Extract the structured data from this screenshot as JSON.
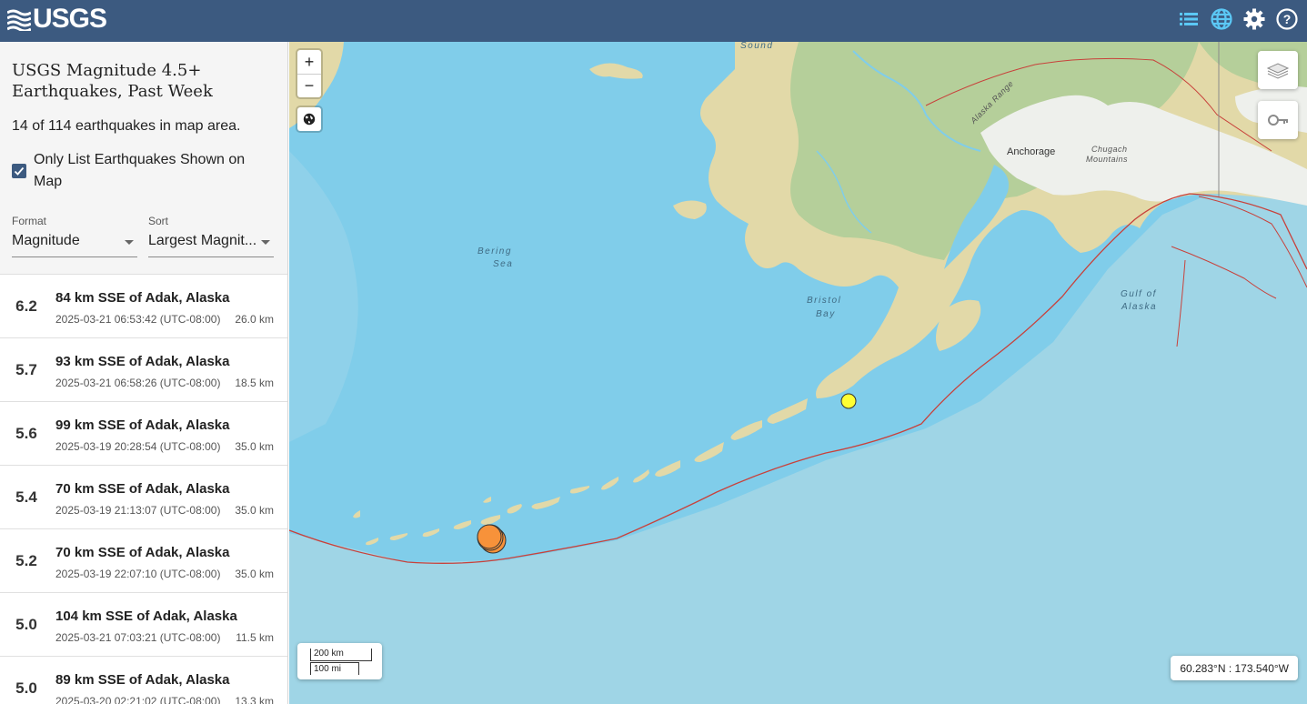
{
  "header": {
    "logo_text": "USGS",
    "icons": [
      "list-icon",
      "globe-icon",
      "gear-icon",
      "help-icon"
    ]
  },
  "sidebar": {
    "title": "USGS Magnitude 4.5+ Earthquakes, Past Week",
    "count_text": "14 of 114 earthquakes in map area.",
    "only_list_checkbox": {
      "label": "Only List Earthquakes Shown on Map",
      "checked": true
    },
    "format": {
      "label": "Format",
      "value": "Magnitude"
    },
    "sort": {
      "label": "Sort",
      "value": "Largest Magnit..."
    }
  },
  "earthquakes": [
    {
      "mag": "6.2",
      "place": "84 km SSE of Adak, Alaska",
      "time": "2025-03-21 06:53:42 (UTC-08:00)",
      "depth": "26.0 km"
    },
    {
      "mag": "5.7",
      "place": "93 km SSE of Adak, Alaska",
      "time": "2025-03-21 06:58:26 (UTC-08:00)",
      "depth": "18.5 km"
    },
    {
      "mag": "5.6",
      "place": "99 km SSE of Adak, Alaska",
      "time": "2025-03-19 20:28:54 (UTC-08:00)",
      "depth": "35.0 km"
    },
    {
      "mag": "5.4",
      "place": "70 km SSE of Adak, Alaska",
      "time": "2025-03-19 21:13:07 (UTC-08:00)",
      "depth": "35.0 km"
    },
    {
      "mag": "5.2",
      "place": "70 km SSE of Adak, Alaska",
      "time": "2025-03-19 22:07:10 (UTC-08:00)",
      "depth": "35.0 km"
    },
    {
      "mag": "5.0",
      "place": "104 km SSE of Adak, Alaska",
      "time": "2025-03-21 07:03:21 (UTC-08:00)",
      "depth": "11.5 km"
    },
    {
      "mag": "5.0",
      "place": "89 km SSE of Adak, Alaska",
      "time": "2025-03-20 02:21:02 (UTC-08:00)",
      "depth": "13.3 km"
    }
  ],
  "map": {
    "zoom_in": "+",
    "zoom_out": "−",
    "scale_km": "200 km",
    "scale_mi": "100 mi",
    "coordinates": "60.283°N : 173.540°W",
    "labels": {
      "sound": "Sound",
      "bering": "Bering",
      "sea": "Sea",
      "bristol": "Bristol",
      "bay": "Bay",
      "gulf": "Gulf of",
      "alaska": "Alaska",
      "anchorage": "Anchorage",
      "chugach": "Chugach",
      "mountains": "Mountains",
      "alaska_range": "Alaska Range"
    },
    "marker_colors": {
      "recent": "#f7923a",
      "older": "#ffff33"
    },
    "colors": {
      "ocean": "#80cdea",
      "land": "#e2d9a8",
      "forest": "#b5cf9a",
      "fault": "#c8413b",
      "header": "#3c5a80"
    }
  }
}
